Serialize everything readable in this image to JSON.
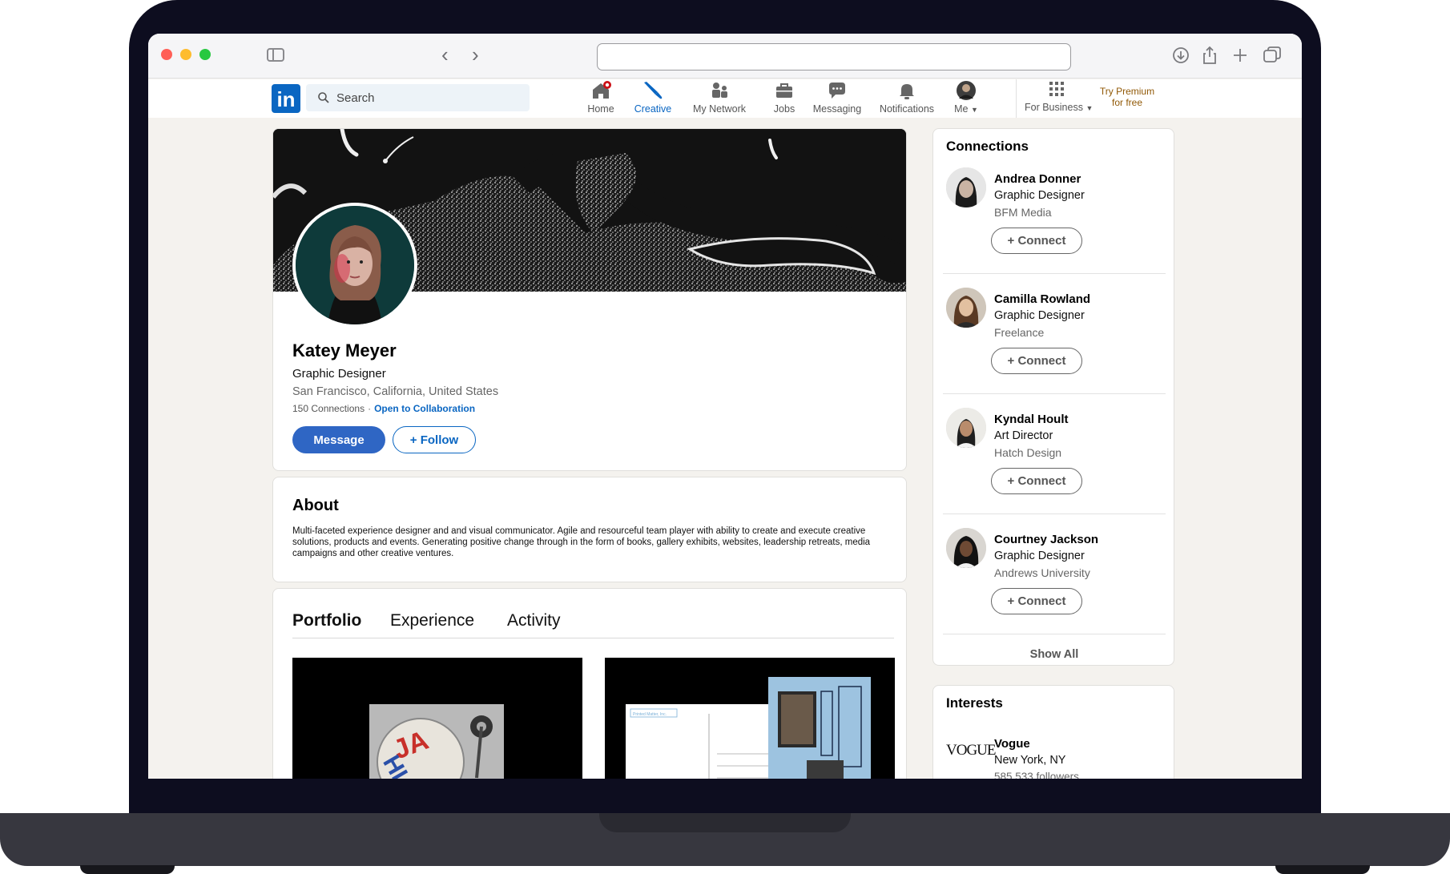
{
  "linkedin": {
    "logo": "in",
    "search_placeholder": "Search",
    "nav": [
      {
        "label": "Home",
        "icon": "home-icon"
      },
      {
        "label": "Creative",
        "icon": "brush-icon"
      },
      {
        "label": "My Network",
        "icon": "network-icon"
      },
      {
        "label": "Jobs",
        "icon": "briefcase-icon"
      },
      {
        "label": "Messaging",
        "icon": "chat-icon"
      },
      {
        "label": "Notifications",
        "icon": "bell-icon"
      },
      {
        "label": "Me",
        "icon": "avatar"
      },
      {
        "label": "For Business",
        "icon": "grid-icon"
      }
    ],
    "premium_line1": "Try Premium",
    "premium_line2": "for free"
  },
  "profile": {
    "name": "Katey Meyer",
    "title": "Graphic Designer",
    "location": "San Francisco, California, United States",
    "connections": "150 Connections",
    "separator": "·",
    "collab": "Open to Collaboration",
    "message_label": "Message",
    "follow_label": "+ Follow"
  },
  "about": {
    "title": "About",
    "text": "Multi-faceted experience designer and and visual communicator. Agile and resourceful team player with ability to create and execute creative solutions, products and events. Generating positive change through in the form of books, gallery exhibits, websites, leadership retreats, media campaigns and other creative ventures."
  },
  "portfolio": {
    "tabs": [
      "Portfolio",
      "Experience",
      "Activity"
    ],
    "thumb2_caption": "Printed Matter, Inc."
  },
  "connections": {
    "title": "Connections",
    "connect_label": "+ Connect",
    "show_all": "Show All",
    "items": [
      {
        "name": "Andrea Donner",
        "title": "Graphic Designer",
        "org": "BFM Media"
      },
      {
        "name": "Camilla Rowland",
        "title": "Graphic Designer",
        "org": "Freelance"
      },
      {
        "name": "Kyndal Hoult",
        "title": "Art Director",
        "org": "Hatch Design"
      },
      {
        "name": "Courtney Jackson",
        "title": "Graphic Designer",
        "org": "Andrews University"
      }
    ]
  },
  "interests": {
    "title": "Interests",
    "logo_text": "VOGUE",
    "name": "Vogue",
    "location": "New York, NY",
    "followers": "585,533 followers"
  },
  "colors": {
    "linkedin_blue": "#0a66c2",
    "premium_gold": "#915907",
    "page_bg": "#f4f2ee"
  }
}
